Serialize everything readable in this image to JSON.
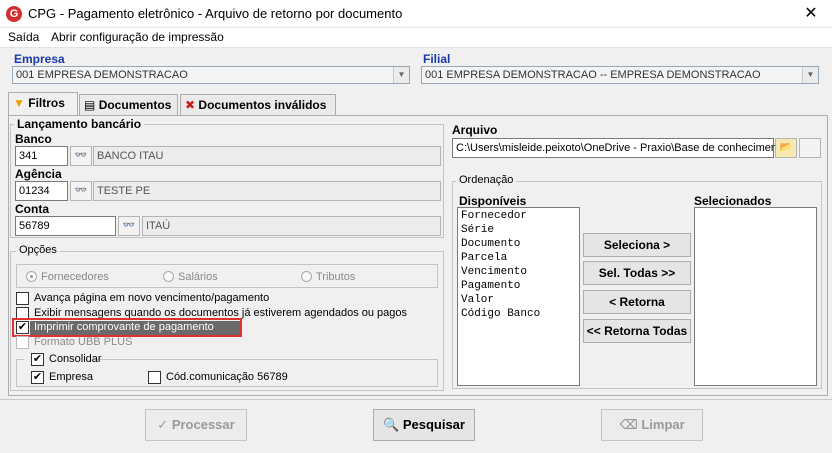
{
  "window": {
    "title": "CPG - Pagamento eletrônico - Arquivo de retorno por documento",
    "icon_letter": "G"
  },
  "menu": {
    "items": [
      "Saída",
      "Abrir configuração de impressão"
    ]
  },
  "empresa": {
    "label": "Empresa",
    "value": "001 EMPRESA DEMONSTRACAO"
  },
  "filial": {
    "label": "Filial",
    "value": "001 EMPRESA DEMONSTRACAO -- EMPRESA DEMONSTRACAO"
  },
  "tabs": [
    {
      "label": "Filtros",
      "icon": "funnel-icon",
      "active": true
    },
    {
      "label": "Documentos",
      "icon": "document-icon",
      "active": false
    },
    {
      "label": "Documentos inválidos",
      "icon": "invalid-document-icon",
      "active": false
    }
  ],
  "lancamento": {
    "title": "Lançamento bancário",
    "banco": {
      "label": "Banco",
      "code": "341",
      "name": "BANCO ITAU"
    },
    "agencia": {
      "label": "Agência",
      "code": "01234",
      "name": "TESTE PE"
    },
    "conta": {
      "label": "Conta",
      "code": "56789",
      "name": "ITAÚ"
    }
  },
  "opcoes": {
    "title": "Opções",
    "radios": [
      {
        "label": "Fornecedores",
        "selected": true
      },
      {
        "label": "Salários",
        "selected": false
      },
      {
        "label": "Tributos",
        "selected": false
      }
    ],
    "checks": [
      {
        "label": "Avança página em novo vencimento/pagamento",
        "checked": false,
        "enabled": true
      },
      {
        "label": "Exibir mensagens quando os documentos já estiverem agendados ou pagos",
        "checked": false,
        "enabled": true
      },
      {
        "label": "Imprimir comprovante de pagamento",
        "checked": true,
        "enabled": true
      },
      {
        "label": "Formato UBB PLUS",
        "checked": false,
        "enabled": false
      }
    ],
    "consolidar": {
      "label": "Consolidar",
      "checked": true,
      "empresa": {
        "label": "Empresa",
        "checked": true
      },
      "cod_comunicacao": {
        "label": "Cód.comunicação 56789",
        "checked": false
      }
    }
  },
  "arquivo": {
    "label": "Arquivo",
    "value": "C:\\Users\\misleide.peixoto\\OneDrive - Praxio\\Base de conheciment"
  },
  "ordenacao": {
    "title": "Ordenação",
    "disponiveis_label": "Disponíveis",
    "selecionados_label": "Selecionados",
    "disponiveis": [
      "Fornecedor",
      "Série",
      "Documento",
      "Parcela",
      "Vencimento",
      "Pagamento",
      "Valor",
      "Código Banco"
    ],
    "selecionados": [],
    "buttons": {
      "seleciona": "Seleciona >",
      "sel_todas": "Sel. Todas >>",
      "retorna": "< Retorna",
      "retorna_todas": "<< Retorna Todas"
    }
  },
  "bottom": {
    "processar": "Processar",
    "pesquisar": "Pesquisar",
    "limpar": "Limpar"
  },
  "colors": {
    "highlight": "#e03030",
    "label_blue": "#1a3aa8"
  }
}
